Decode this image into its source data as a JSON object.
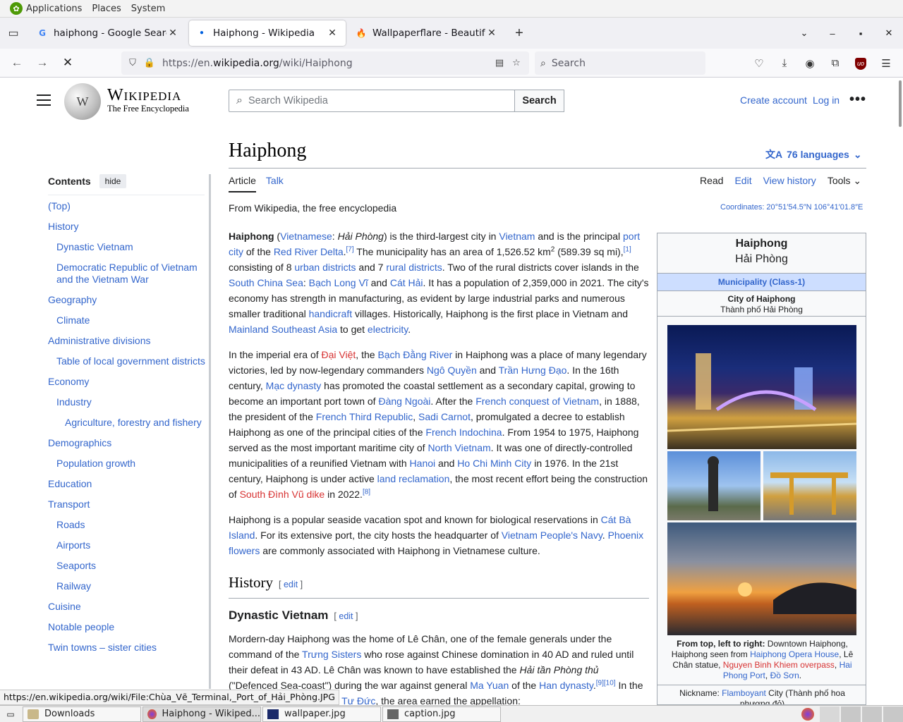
{
  "gnome": {
    "applications": "Applications",
    "places": "Places",
    "system": "System"
  },
  "tabs": [
    {
      "title": "haiphong - Google Search",
      "favicon": "G"
    },
    {
      "title": "Haiphong - Wikipedia",
      "favicon": "•"
    },
    {
      "title": "Wallpaperflare - Beautiful H",
      "favicon": "🔥"
    }
  ],
  "urlbar": {
    "url_prefix": "https://en.",
    "url_domain": "wikipedia.org",
    "url_path": "/wiki/Haiphong"
  },
  "searchbar": {
    "placeholder": "Search"
  },
  "wiki": {
    "wordmark_title": "Wikipedia",
    "wordmark_tagline": "The Free Encyclopedia",
    "search_placeholder": "Search Wikipedia",
    "search_button": "Search",
    "create_account": "Create account",
    "log_in": "Log in",
    "more": "•••"
  },
  "toc": {
    "heading": "Contents",
    "hide": "hide",
    "items": [
      {
        "label": "(Top)",
        "level": 1
      },
      {
        "label": "History",
        "level": 1
      },
      {
        "label": "Dynastic Vietnam",
        "level": 2
      },
      {
        "label": "Democratic Republic of Vietnam and the Vietnam War",
        "level": 2
      },
      {
        "label": "Geography",
        "level": 1
      },
      {
        "label": "Climate",
        "level": 2
      },
      {
        "label": "Administrative divisions",
        "level": 1
      },
      {
        "label": "Table of local government districts",
        "level": 2
      },
      {
        "label": "Economy",
        "level": 1
      },
      {
        "label": "Industry",
        "level": 2
      },
      {
        "label": "Agriculture, forestry and fishery",
        "level": 3
      },
      {
        "label": "Demographics",
        "level": 1
      },
      {
        "label": "Population growth",
        "level": 2
      },
      {
        "label": "Education",
        "level": 1
      },
      {
        "label": "Transport",
        "level": 1
      },
      {
        "label": "Roads",
        "level": 2
      },
      {
        "label": "Airports",
        "level": 2
      },
      {
        "label": "Seaports",
        "level": 2
      },
      {
        "label": "Railway",
        "level": 2
      },
      {
        "label": "Cuisine",
        "level": 1
      },
      {
        "label": "Notable people",
        "level": 1
      },
      {
        "label": "Twin towns – sister cities",
        "level": 1
      }
    ]
  },
  "article": {
    "title": "Haiphong",
    "languages": "76 languages",
    "tab_article": "Article",
    "tab_talk": "Talk",
    "tab_read": "Read",
    "tab_edit": "Edit",
    "tab_history": "View history",
    "tab_tools": "Tools",
    "tagline": "From Wikipedia, the free encyclopedia",
    "coordinates": "Coordinates: 20°51′54.5″N 106°41′01.8″E",
    "section_history": "History",
    "section_dynastic": "Dynastic Vietnam",
    "edit": "edit"
  },
  "infobox": {
    "name": "Haiphong",
    "native_name": "Hải Phòng",
    "type": "Municipality (Class-1)",
    "official_name": "City of Haiphong",
    "official_native": "Thành phố Hải Phòng",
    "caption_lead": "From top, left to right:",
    "nickname_label": "Nickname:",
    "nickname_link": "Flamboyant",
    "nickname_rest": "City (Thành phố hoa phượng đỏ)"
  },
  "status_url": "https://en.wikipedia.org/wiki/File:Chùa_Vẽ_Terminal,_Port_of_Hải_Phòng.JPG",
  "taskbar": [
    {
      "label": "Downloads",
      "active": false
    },
    {
      "label": "Haiphong - Wikiped...",
      "active": true
    },
    {
      "label": "wallpaper.jpg",
      "active": false
    },
    {
      "label": "caption.jpg",
      "active": false
    }
  ],
  "colors": {
    "link": "#3366cc",
    "redlink": "#d73333",
    "infobox_type_bg": "#cddeff"
  }
}
